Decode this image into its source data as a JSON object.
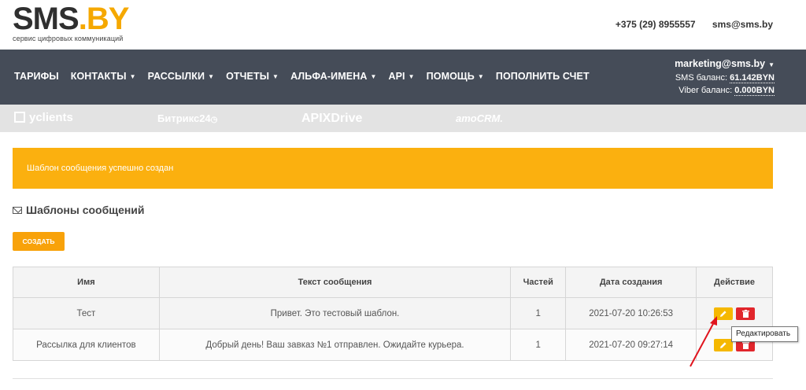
{
  "header": {
    "logo_main": "SMS",
    "logo_dot": ".",
    "logo_by": "BY",
    "logo_sub": "сервис цифровых коммуникаций",
    "phone": "+375 (29) 8955557",
    "email": "sms@sms.by"
  },
  "nav": {
    "items": [
      {
        "label": "ТАРИФЫ"
      },
      {
        "label": "КОНТАКТЫ"
      },
      {
        "label": "РАССЫЛКИ"
      },
      {
        "label": "ОТЧЕТЫ"
      },
      {
        "label": "АЛЬФА-ИМЕНА"
      },
      {
        "label": "API"
      },
      {
        "label": "ПОМОЩЬ"
      },
      {
        "label": "ПОПОЛНИТЬ СЧЕТ"
      }
    ],
    "account_email": "marketing@sms.by",
    "sms_balance_label": "SMS баланс:",
    "sms_balance_value": "61.142BYN",
    "viber_balance_label": "Viber баланс:",
    "viber_balance_value": "0.000BYN"
  },
  "partners": [
    "yclients",
    "Битрикс24",
    "APIXDrive",
    "amoCRM."
  ],
  "alert": {
    "text": "Шаблон сообщения успешно создан"
  },
  "section": {
    "title": "Шаблоны сообщений",
    "create_label": "СОЗДАТЬ"
  },
  "table": {
    "headers": [
      "Имя",
      "Текст сообщения",
      "Частей",
      "Дата создания",
      "Действие"
    ],
    "rows": [
      {
        "name": "Тест",
        "text": "Привет. Это тестовый шаблон.",
        "parts": "1",
        "created": "2021-07-20 10:26:53"
      },
      {
        "name": "Рассылка для клиентов",
        "text": "Добрый день! Ваш завказ №1 отправлен. Ожидайте курьера.",
        "parts": "1",
        "created": "2021-07-20 09:27:14"
      }
    ]
  },
  "tooltip": {
    "text": "Редактировать"
  },
  "colors": {
    "accent": "#fbb00f",
    "nav_bg": "#454c58",
    "danger": "#e1262c"
  },
  "icons": {
    "edit": "pencil-icon",
    "delete": "trash-icon",
    "section": "envelope-icon",
    "caret": "caret-down-icon"
  }
}
